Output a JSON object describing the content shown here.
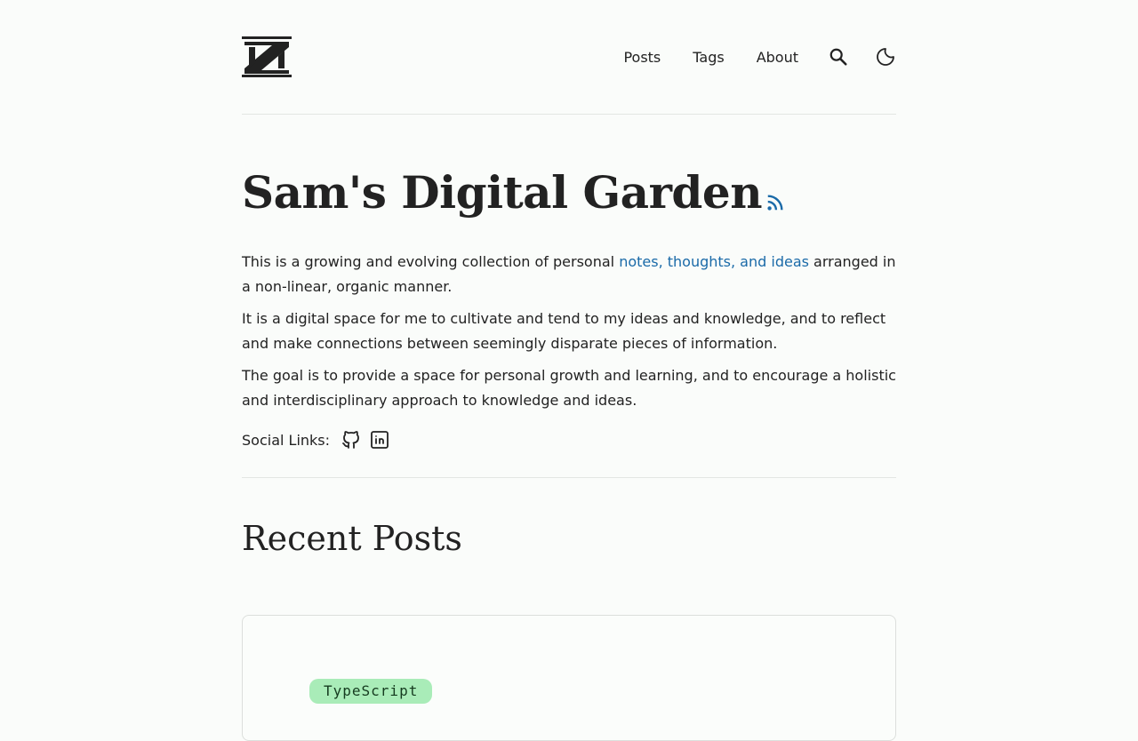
{
  "header": {
    "logo_alt": "Z",
    "nav": [
      {
        "label": "Posts"
      },
      {
        "label": "Tags"
      },
      {
        "label": "About"
      }
    ],
    "icons": [
      "search-icon",
      "moon-icon"
    ]
  },
  "hero": {
    "title": "Sam's Digital Garden",
    "rss_icon": "rss-icon",
    "rss_color": "#1a6aa8"
  },
  "intro": {
    "p1_before": "This is a growing and evolving collection of personal ",
    "p1_link": "notes, thoughts, and ideas",
    "p1_after": " arranged in a non-linear, organic manner.",
    "p2": "It is a digital space for me to cultivate and tend to my ideas and knowledge, and to reflect and make connections between seemingly disparate pieces of information.",
    "p3": "The goal is to provide a space for personal growth and learning, and to encourage a holistic and interdisciplinary approach to knowledge and ideas."
  },
  "social": {
    "label": "Social Links:",
    "icons": [
      "github-icon",
      "linkedin-icon"
    ]
  },
  "recent": {
    "heading": "Recent Posts",
    "posts": [
      {
        "tag": "TypeScript"
      }
    ]
  },
  "colors": {
    "background": "#fafcfa",
    "link": "#1a6aa8",
    "tag_bg": "#a9ecb8"
  }
}
